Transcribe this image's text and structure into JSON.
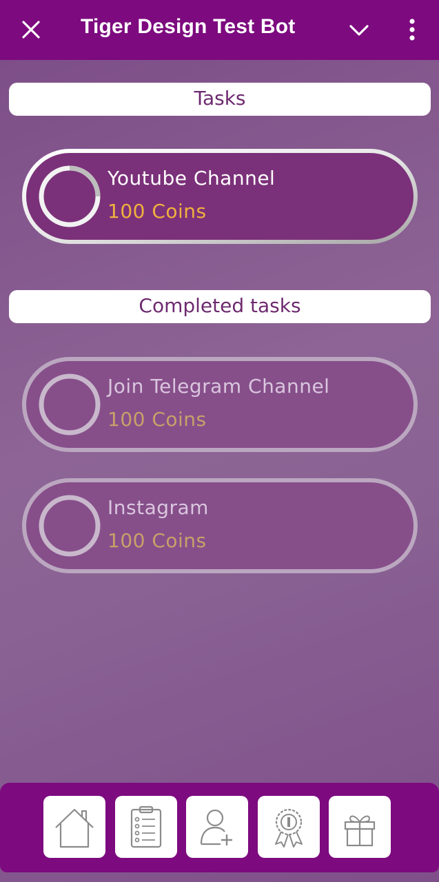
{
  "header": {
    "title": "Tiger Design Test Bot",
    "close_icon": "close-icon",
    "dropdown_icon": "chevron-down-icon",
    "menu_icon": "more-vertical-icon"
  },
  "sections": {
    "tasks_title": "Tasks",
    "completed_title": "Completed tasks"
  },
  "tasks": [
    {
      "label": "Youtube Channel",
      "reward": "100 Coins",
      "status": "pending"
    }
  ],
  "completed_tasks": [
    {
      "label": "Join Telegram Channel",
      "reward": "100 Coins",
      "status": "completed"
    },
    {
      "label": "Instagram",
      "reward": "100 Coins",
      "status": "completed"
    }
  ],
  "navbar": {
    "items": [
      "home-icon",
      "clipboard-checklist-icon",
      "add-user-icon",
      "award-badge-icon",
      "gift-icon"
    ]
  },
  "colors": {
    "brand": "#7d0a7f",
    "coins": "#f0b13e",
    "pill": "#7b3179"
  }
}
